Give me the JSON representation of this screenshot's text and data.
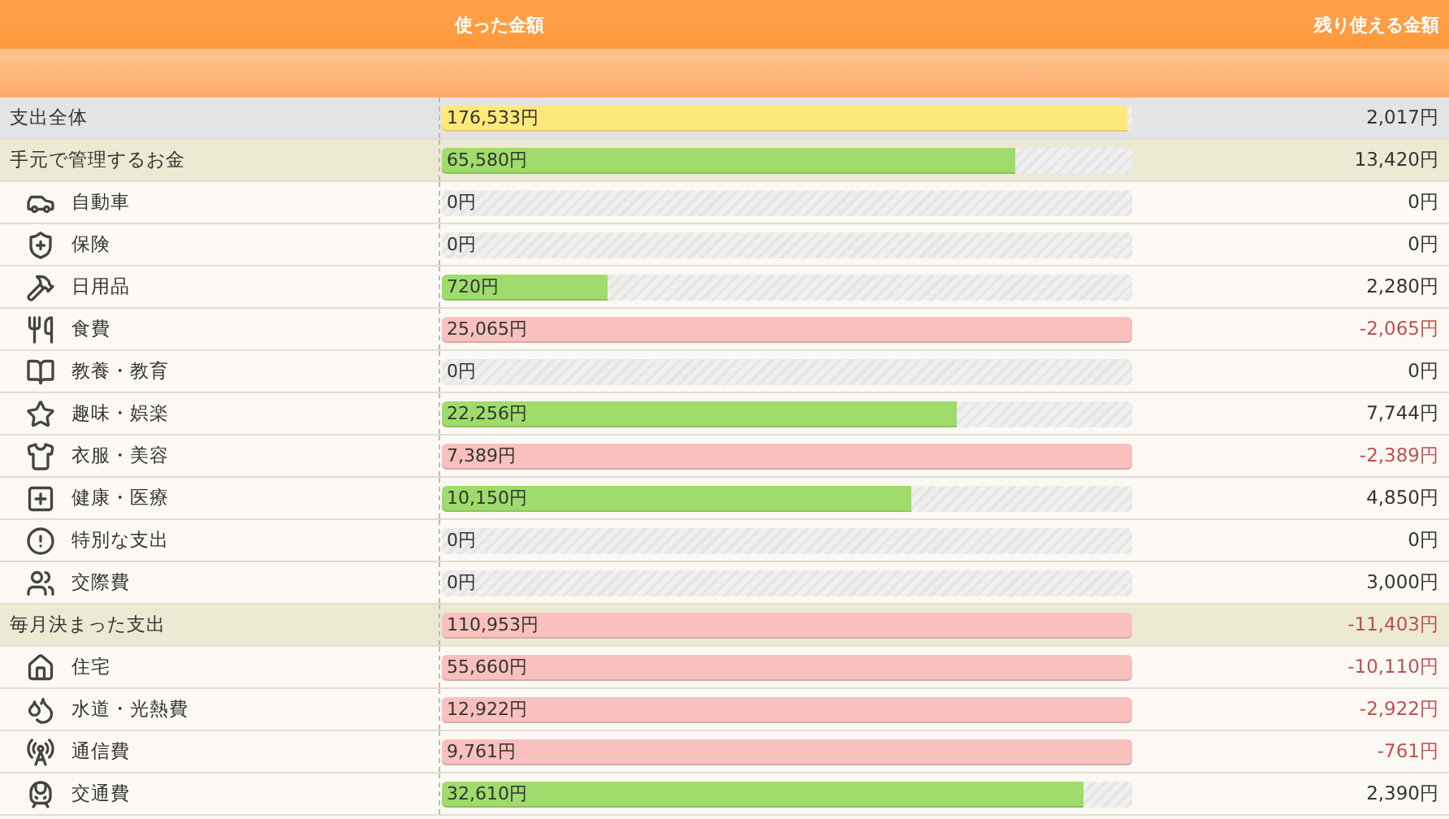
{
  "header": {
    "spent_label": "使った金額",
    "remaining_label": "残り使える金額"
  },
  "rows": [
    {
      "kind": "total",
      "label": "支出全体",
      "spent": "176,533円",
      "color": "#fde97a",
      "level": 0.992,
      "remaining": "2,017円",
      "negative": false
    },
    {
      "kind": "group",
      "label": "手元で管理するお金",
      "spent": "65,580円",
      "color": "#9fdc6c",
      "level": 0.83,
      "remaining": "13,420円",
      "negative": false
    },
    {
      "kind": "item",
      "label": "自動車",
      "spent": "0円",
      "remaining": "0円",
      "negative": false
    },
    {
      "kind": "item",
      "label": "保険",
      "spent": "0円",
      "remaining": "0円",
      "negative": false
    },
    {
      "kind": "item",
      "label": "日用品",
      "spent": "720円",
      "color": "#9fdc6c",
      "level": 0.24,
      "remaining": "2,280円",
      "negative": false
    },
    {
      "kind": "item",
      "label": "食費",
      "spent": "25,065円",
      "color": "#f9c1bd",
      "level": 1,
      "remaining": "-2,065円",
      "negative": true
    },
    {
      "kind": "item",
      "label": "教養・教育",
      "spent": "0円",
      "remaining": "0円",
      "negative": false
    },
    {
      "kind": "item",
      "label": "趣味・娯楽",
      "spent": "22,256円",
      "color": "#9fdc6c",
      "level": 0.745,
      "remaining": "7,744円",
      "negative": false
    },
    {
      "kind": "item",
      "label": "衣服・美容",
      "spent": "7,389円",
      "color": "#f9c1bd",
      "level": 1,
      "remaining": "-2,389円",
      "negative": true
    },
    {
      "kind": "item",
      "label": "健康・医療",
      "spent": "10,150円",
      "color": "#9fdc6c",
      "level": 0.68,
      "remaining": "4,850円",
      "negative": false
    },
    {
      "kind": "item",
      "label": "特別な支出",
      "spent": "0円",
      "remaining": "0円",
      "negative": false
    },
    {
      "kind": "item",
      "label": "交際費",
      "spent": "0円",
      "remaining": "3,000円",
      "negative": false
    },
    {
      "kind": "group",
      "label": "毎月決まった支出",
      "spent": "110,953円",
      "color": "#f9c1bd",
      "level": 1,
      "remaining": "-11,403円",
      "negative": true
    },
    {
      "kind": "item",
      "label": "住宅",
      "spent": "55,660円",
      "color": "#f9c1bd",
      "level": 1,
      "remaining": "-10,110円",
      "negative": true
    },
    {
      "kind": "item",
      "label": "水道・光熱費",
      "spent": "12,922円",
      "color": "#f9c1bd",
      "level": 1,
      "remaining": "-2,922円",
      "negative": true
    },
    {
      "kind": "item",
      "label": "通信費",
      "spent": "9,761円",
      "color": "#f9c1bd",
      "level": 1,
      "remaining": "-761円",
      "negative": true
    },
    {
      "kind": "item",
      "label": "交通費",
      "spent": "32,610円",
      "color": "#9fdc6c",
      "level": 0.93,
      "remaining": "2,390円",
      "negative": false
    }
  ]
}
